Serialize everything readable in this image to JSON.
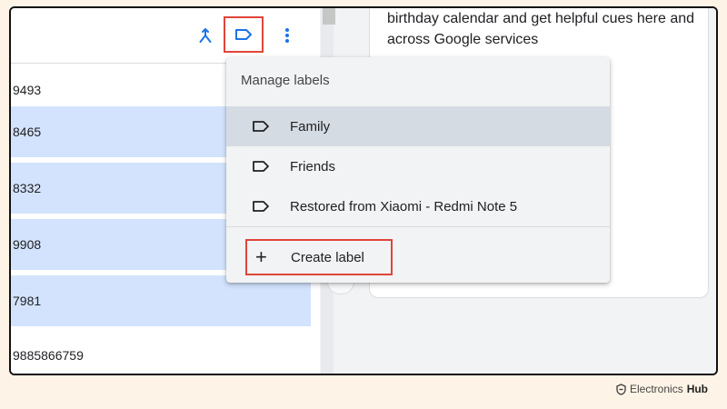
{
  "toolbar": {
    "icons": [
      "merge-icon",
      "label-icon",
      "more-vert-icon"
    ],
    "accent": "#1a73e8",
    "highlight_color": "#e0453a"
  },
  "contacts": [
    {
      "phone": "9493",
      "selected": false
    },
    {
      "phone": "8465",
      "selected": true
    },
    {
      "phone": "8332",
      "selected": true
    },
    {
      "phone": "9908",
      "selected": true
    },
    {
      "phone": "7981",
      "selected": true
    },
    {
      "phone": "9885866759",
      "selected": false
    }
  ],
  "card": {
    "text_line1": "birthday calendar and get helpful cues here and",
    "text_line2": "across Google services"
  },
  "menu": {
    "header": "Manage labels",
    "items": [
      {
        "label": "Family",
        "highlighted": true
      },
      {
        "label": "Friends",
        "highlighted": false
      },
      {
        "label": "Restored from Xiaomi - Redmi Note 5",
        "highlighted": false
      }
    ],
    "create_label": "Create label"
  },
  "watermark": {
    "brand_light": "Electronics",
    "brand_bold": "Hub"
  },
  "colors": {
    "selected_row": "#d3e3fd",
    "menu_bg": "#f1f3f4",
    "menu_highlight": "#d5dbe2",
    "page_bg": "#fdf3e6"
  }
}
